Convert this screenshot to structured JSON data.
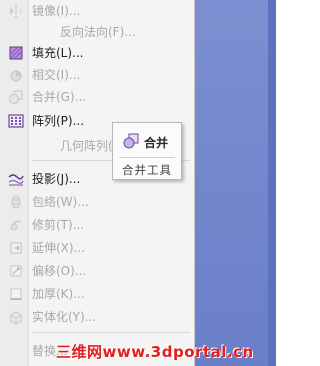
{
  "menu": {
    "items": [
      {
        "label": "镜像(I)...",
        "enabled": false,
        "icon": "mirror-icon"
      },
      {
        "label": "反向法向(F)...",
        "enabled": false,
        "icon": null
      },
      {
        "label": "填充(L)...",
        "enabled": true,
        "icon": "fill-icon"
      },
      {
        "label": "相交(I)...",
        "enabled": false,
        "icon": "intersect-icon"
      },
      {
        "label": "合并(G)...",
        "enabled": false,
        "icon": "merge-icon"
      },
      {
        "label": "阵列(P)...",
        "enabled": true,
        "icon": "array-icon"
      },
      {
        "label": "几何阵列(G)...",
        "enabled": false,
        "icon": null
      },
      {
        "label": "投影(J)...",
        "enabled": true,
        "icon": "project-icon"
      },
      {
        "label": "包络(W)...",
        "enabled": false,
        "icon": "wrap-icon"
      },
      {
        "label": "修剪(T)...",
        "enabled": false,
        "icon": "trim-icon"
      },
      {
        "label": "延伸(X)...",
        "enabled": false,
        "icon": "extend-icon"
      },
      {
        "label": "偏移(O)...",
        "enabled": false,
        "icon": "offset-icon"
      },
      {
        "label": "加厚(K)...",
        "enabled": false,
        "icon": "thicken-icon"
      },
      {
        "label": "实体化(Y)...",
        "enabled": false,
        "icon": "solidify-icon"
      },
      {
        "label": "替换...",
        "enabled": false,
        "icon": null
      }
    ]
  },
  "tooltip": {
    "title": "合并",
    "subtitle": "合并工具"
  },
  "watermark": "三维网www.3dportal.cn",
  "colors": {
    "accent": "#6a7fc8",
    "watermark": "#e02020"
  }
}
